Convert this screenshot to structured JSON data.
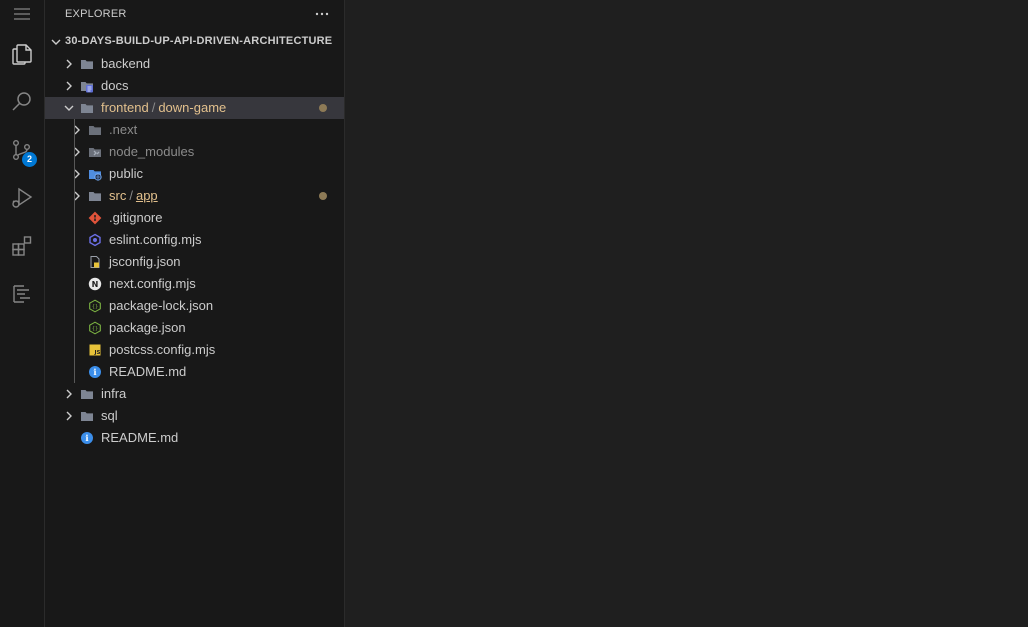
{
  "colors": {
    "background": "#1f1f1f",
    "sidebar": "#181818",
    "selected_row": "#37373d",
    "modified_text": "#e2c08d",
    "modified_dot": "#8d7a56",
    "badge": "#0078d4",
    "folder_icon": "#7e8593"
  },
  "activity_bar": {
    "items": [
      {
        "name": "menu-icon"
      },
      {
        "name": "explorer-files-icon"
      },
      {
        "name": "search-icon"
      },
      {
        "name": "source-control-icon",
        "badge": "2"
      },
      {
        "name": "run-debug-icon"
      },
      {
        "name": "extensions-icon"
      },
      {
        "name": "outline-icon"
      }
    ]
  },
  "sidebar": {
    "title": "EXPLORER",
    "more_label": "···",
    "project": "30-DAYS-BUILD-UP-API-DRIVEN-ARCHITECTURE",
    "tree": {
      "backend": "backend",
      "docs": "docs",
      "frontend_a": "frontend",
      "frontend_b": "down-game",
      "next": ".next",
      "node_modules": "node_modules",
      "public": "public",
      "src_a": "src",
      "src_b": "app",
      "gitignore": ".gitignore",
      "eslint": "eslint.config.mjs",
      "jsconfig": "jsconfig.json",
      "nextconfig": "next.config.mjs",
      "packagelock": "package-lock.json",
      "package": "package.json",
      "postcss": "postcss.config.mjs",
      "readme_inner": "README.md",
      "infra": "infra",
      "sql": "sql",
      "readme_root": "README.md",
      "separator": "/",
      "next_icon_letter": "N",
      "js_icon_label": "JS",
      "info_icon_letter": "i",
      "curly_icon_label": "{}"
    }
  }
}
